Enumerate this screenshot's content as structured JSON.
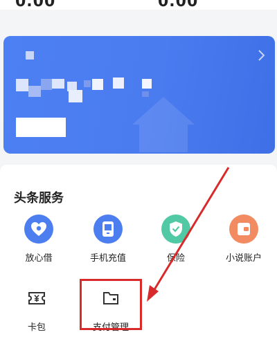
{
  "top_values": {
    "left": "0.00",
    "right": "0.00"
  },
  "section": {
    "title": "头条服务"
  },
  "services": [
    {
      "label": "放心借",
      "icon": "heart-coin-icon",
      "color": "#4d7ef0"
    },
    {
      "label": "手机充值",
      "icon": "phone-recharge-icon",
      "color": "#4d7ef0"
    },
    {
      "label": "保险",
      "icon": "shield-check-icon",
      "color": "#52c9a5"
    },
    {
      "label": "小说账户",
      "icon": "wallet-icon",
      "color": "#f38b62"
    },
    {
      "label": "卡包",
      "icon": "yuan-ticket-icon",
      "color": "#333333"
    },
    {
      "label": "支付管理",
      "icon": "folder-icon",
      "color": "#333333"
    }
  ],
  "annotation": {
    "color": "#d82a2a"
  },
  "banner": {
    "color": "#4a7cf0"
  }
}
